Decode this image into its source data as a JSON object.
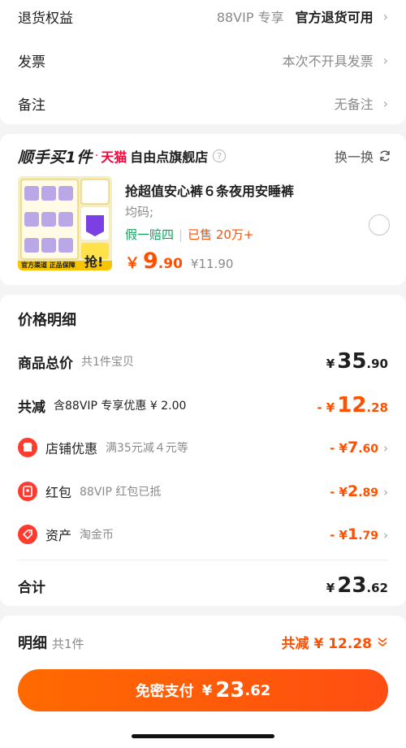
{
  "top_rows": {
    "refund": {
      "label": "退货权益",
      "value": "88VIP 专享",
      "value_bold": "官方退货可用"
    },
    "invoice": {
      "label": "发票",
      "value": "本次不开具发票"
    },
    "note": {
      "label": "备注",
      "value": "无备注"
    }
  },
  "shop": {
    "brand": "顺手买1件",
    "dot": "·",
    "platform": "天猫",
    "name": "自由点旗舰店",
    "help": "?",
    "swap": "换一换"
  },
  "product": {
    "thumb_badge": "抢!",
    "thumb_text": "官方渠道 正品保障",
    "title": "抢超值安心裤６条夜用安睡裤",
    "spec": "均码;",
    "tag_green": "假一赔四",
    "tag_sep": "|",
    "tag_sold": "已售 20万+",
    "yen": "￥",
    "price_int": "9",
    "price_dec": ".90",
    "orig_price": "¥11.90"
  },
  "price_detail": {
    "title": "价格明细",
    "total": {
      "label": "商品总价",
      "sub": "共1件宝贝",
      "yen": "¥",
      "int": "35",
      "dec": ".90"
    },
    "reduce": {
      "label": "共减",
      "sub": "含88VIP 专享优惠 ¥ 2.00",
      "yen": "- ¥",
      "int": "12",
      "dec": ".28"
    },
    "shop_discount": {
      "label": "店铺优惠",
      "sub": "满35元减４元等",
      "minus": "- ¥",
      "int": "7",
      "dec": ".60"
    },
    "redpacket": {
      "label": "红包",
      "sub": "88VIP 红包已抵",
      "minus": "- ¥",
      "int": "2",
      "dec": ".89"
    },
    "assets": {
      "label": "资产",
      "sub": "淘金币",
      "minus": "- ¥",
      "int": "1",
      "dec": ".79"
    },
    "sum": {
      "label": "合计",
      "yen": "¥",
      "int": "23",
      "dec": ".62"
    }
  },
  "bottom": {
    "detail_label": "明细",
    "detail_count": "共1件",
    "reduce_text": "共减 ¥ 12.28",
    "pay_label": "免密支付",
    "pay_yen": "¥",
    "pay_int": "23",
    "pay_dec": ".62"
  },
  "colors": {
    "accent": "#ff5000",
    "green": "#11a35d",
    "tmall": "#ff0036"
  }
}
